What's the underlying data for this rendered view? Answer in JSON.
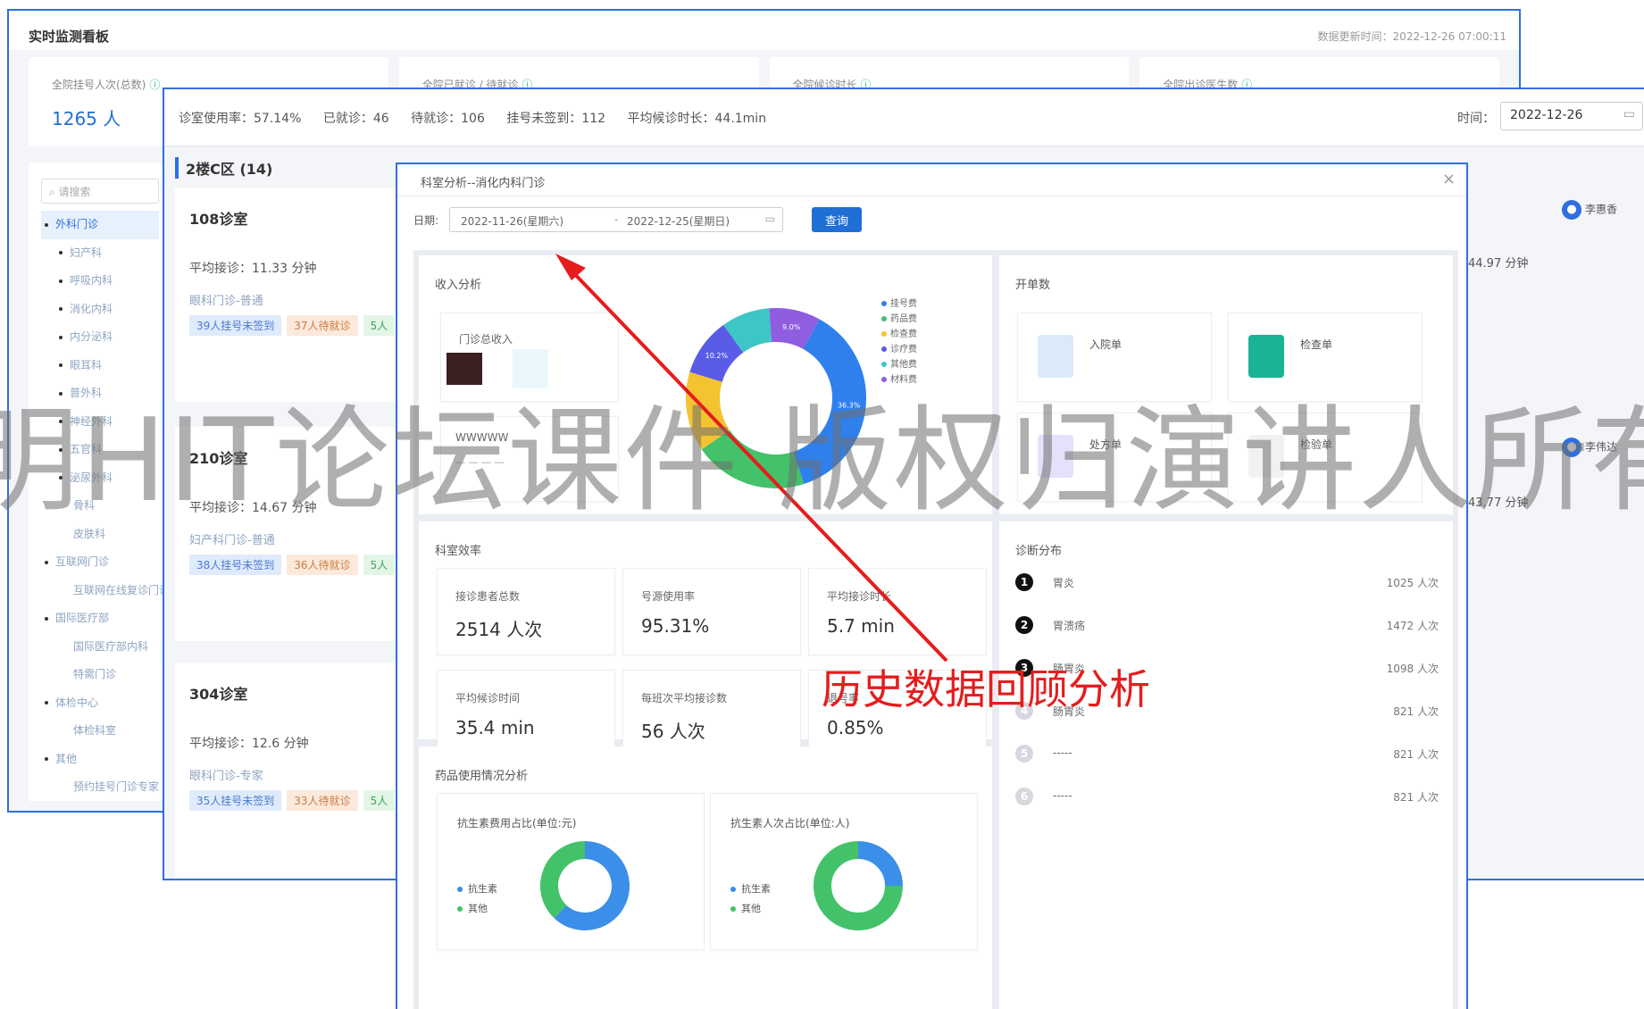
{
  "back_window": {
    "title": "实时监测看板",
    "updated": "数据更新时间：2022-12-26 07:00:11",
    "stats": [
      {
        "label": "全院挂号人次(总数)",
        "value": "1265 人"
      },
      {
        "label": "全院已就诊 / 待就诊",
        "value": ""
      },
      {
        "label": "全院候诊时长",
        "value": ""
      },
      {
        "label": "全院出诊医生数",
        "value": ""
      }
    ],
    "search_placeholder": "请搜索",
    "tree": [
      {
        "label": "外科门诊",
        "level": 0,
        "bullet": true,
        "active": true
      },
      {
        "label": "妇产科",
        "level": 1,
        "bullet": true
      },
      {
        "label": "呼吸内科",
        "level": 1,
        "bullet": true
      },
      {
        "label": "消化内科",
        "level": 1,
        "bullet": true
      },
      {
        "label": "内分泌科",
        "level": 1,
        "bullet": true
      },
      {
        "label": "眼耳科",
        "level": 1,
        "bullet": true
      },
      {
        "label": "普外科",
        "level": 1,
        "bullet": true
      },
      {
        "label": "神经外科",
        "level": 1,
        "bullet": true
      },
      {
        "label": "五官科",
        "level": 1,
        "bullet": true
      },
      {
        "label": "泌尿外科",
        "level": 1,
        "bullet": true
      },
      {
        "label": "骨科",
        "level": 2,
        "bullet": false
      },
      {
        "label": "皮肤科",
        "level": 2,
        "bullet": false
      },
      {
        "label": "互联网门诊",
        "level": 0,
        "bullet": true
      },
      {
        "label": "互联网在线复诊门诊",
        "level": 2,
        "bullet": false
      },
      {
        "label": "国际医疗部",
        "level": 0,
        "bullet": true
      },
      {
        "label": "国际医疗部内科",
        "level": 2,
        "bullet": false
      },
      {
        "label": "特需门诊",
        "level": 2,
        "bullet": false
      },
      {
        "label": "体检中心",
        "level": 0,
        "bullet": true
      },
      {
        "label": "体检科室",
        "level": 2,
        "bullet": false
      },
      {
        "label": "其他",
        "level": 0,
        "bullet": true
      },
      {
        "label": "预约挂号门诊专家",
        "level": 2,
        "bullet": false
      }
    ]
  },
  "mid_window": {
    "summary": [
      "诊室使用率：57.14%",
      "已就诊：46",
      "待就诊：106",
      "挂号未签到：112",
      "平均候诊时长：44.1min"
    ],
    "date_label": "时间：",
    "date_value": "2022-12-26",
    "area_title": "2楼C区 (14)",
    "rooms": [
      {
        "name": "108诊室",
        "avg": "平均接诊：11.33 分钟",
        "dept": "眼科门诊-普通",
        "tags": [
          "39人挂号未签到",
          "37人待就诊",
          "5人"
        ]
      },
      {
        "name": "210诊室",
        "avg": "平均接诊：14.67 分钟",
        "dept": "妇产科门诊-普通",
        "tags": [
          "38人挂号未签到",
          "36人待就诊",
          "5人"
        ]
      },
      {
        "name": "304诊室",
        "avg": "平均接诊：12.6 分钟",
        "dept": "眼科门诊-专家",
        "tags": [
          "35人挂号未签到",
          "33人待就诊",
          "5人"
        ]
      }
    ],
    "doctors": [
      "李惠香",
      "李伟达"
    ],
    "durations": [
      "44.97 分钟",
      "43.77 分钟"
    ]
  },
  "modal": {
    "title": "科室分析--消化内科门诊",
    "date_label": "日期:",
    "date_start": "2022-11-26(星期六)",
    "date_sep": "-",
    "date_end": "2022-12-25(星期日)",
    "query_label": "查询",
    "income": {
      "title": "收入分析",
      "card1_label": "门诊总收入",
      "card2_label": "WWWWW",
      "card2_value": "— — — —",
      "colors": {
        "dark": "#3a2020",
        "light": "#eaf8fb"
      }
    },
    "orders": {
      "title": "开单数",
      "items": [
        {
          "label": "入院单",
          "icon": "admission-icon",
          "color": "#3b8fe8"
        },
        {
          "label": "检查单",
          "icon": "exam-bag-icon",
          "color": "#1ab394"
        },
        {
          "label": "处方单",
          "icon": "prescription-icon",
          "color": "#7b61e8"
        },
        {
          "label": "检验单",
          "icon": "lab-icon",
          "color": "#e0e0e0"
        }
      ]
    },
    "efficiency": {
      "title": "科室效率",
      "kpis": [
        {
          "label": "接诊患者总数",
          "value": "2514 人次"
        },
        {
          "label": "号源使用率",
          "value": "95.31%"
        },
        {
          "label": "平均接诊时长",
          "value": "5.7 min"
        },
        {
          "label": "平均候诊时间",
          "value": "35.4 min"
        },
        {
          "label": "每班次平均接诊数",
          "value": "56 人次"
        },
        {
          "label": "退号率",
          "value": "0.85%"
        }
      ]
    },
    "diagnosis": {
      "title": "诊断分布",
      "rows": [
        {
          "rank": "1",
          "name": "胃炎",
          "count": "1025 人次"
        },
        {
          "rank": "2",
          "name": "胃溃疡",
          "count": "1472 人次"
        },
        {
          "rank": "3",
          "name": "肠胃炎",
          "count": "1098 人次"
        },
        {
          "rank": "4",
          "name": "肠胃炎",
          "count": "821 人次"
        },
        {
          "rank": "5",
          "name": "-----",
          "count": "821 人次"
        },
        {
          "rank": "6",
          "name": "-----",
          "count": "821 人次"
        }
      ]
    },
    "drug": {
      "title": "药品使用情况分析",
      "cards": [
        {
          "label": "抗生素费用占比(单位:元)",
          "legend": [
            "抗生素",
            "其他"
          ],
          "fraction": 0.62
        },
        {
          "label": "抗生素人次占比(单位:人)",
          "legend": [
            "抗生素",
            "其他"
          ],
          "fraction": 0.25
        }
      ],
      "colors": {
        "a": "#3b8fe8",
        "b": "#43c26a"
      }
    }
  },
  "donut": {
    "legend": [
      "挂号费",
      "药品费",
      "检查费",
      "诊疗费",
      "其他费",
      "材料费"
    ],
    "segments": [
      {
        "label": "36.3%",
        "value": 36.3,
        "color": "#2f80ed"
      },
      {
        "label": "",
        "value": 20.0,
        "color": "#43c26a"
      },
      {
        "label": "",
        "value": 14.0,
        "color": "#f4c430"
      },
      {
        "label": "10.2%",
        "value": 10.2,
        "color": "#5a5ce8"
      },
      {
        "label": "",
        "value": 8.5,
        "color": "#3ec6c6"
      },
      {
        "label": "9.0%",
        "value": 9.0,
        "color": "#8e5de0"
      }
    ],
    "colors": [
      "#2f80ed",
      "#43c26a",
      "#f4c430",
      "#5a5ce8",
      "#3ec6c6",
      "#8e5de0"
    ]
  },
  "annotation": {
    "text": "历史数据回顾分析",
    "color": "#e51d1d"
  },
  "watermark": "明HIT论坛课件 版权归演讲人所有"
}
